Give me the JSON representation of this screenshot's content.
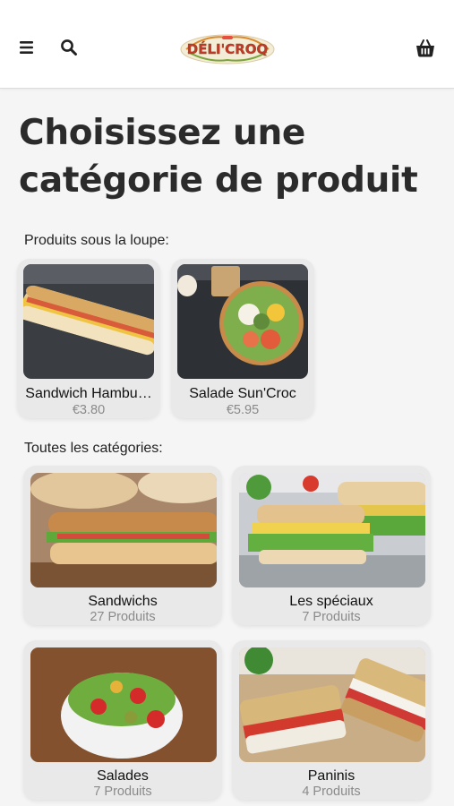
{
  "header": {
    "logo_text": "DÉLI'CROQ",
    "menu_icon": "hamburger-menu-icon",
    "search_icon": "search-icon",
    "cart_icon": "basket-icon"
  },
  "page": {
    "title": "Choisissez une catégorie de produit"
  },
  "spotlight": {
    "label": "Produits sous la loupe:",
    "items": [
      {
        "name": "Sandwich Hambu…",
        "price": "€3.80"
      },
      {
        "name": "Salade Sun'Croc",
        "price": "€5.95"
      }
    ]
  },
  "categories": {
    "label": "Toutes les catégories:",
    "items": [
      {
        "name": "Sandwichs",
        "count": "27 Produits"
      },
      {
        "name": "Les spéciaux",
        "count": "7 Produits"
      },
      {
        "name": "Salades",
        "count": "7 Produits"
      },
      {
        "name": "Paninis",
        "count": "4 Produits"
      }
    ]
  },
  "colors": {
    "background": "#f5f5f5",
    "card": "#e9e9e9",
    "title": "#2b2b2b",
    "muted": "#8a8a8a"
  }
}
